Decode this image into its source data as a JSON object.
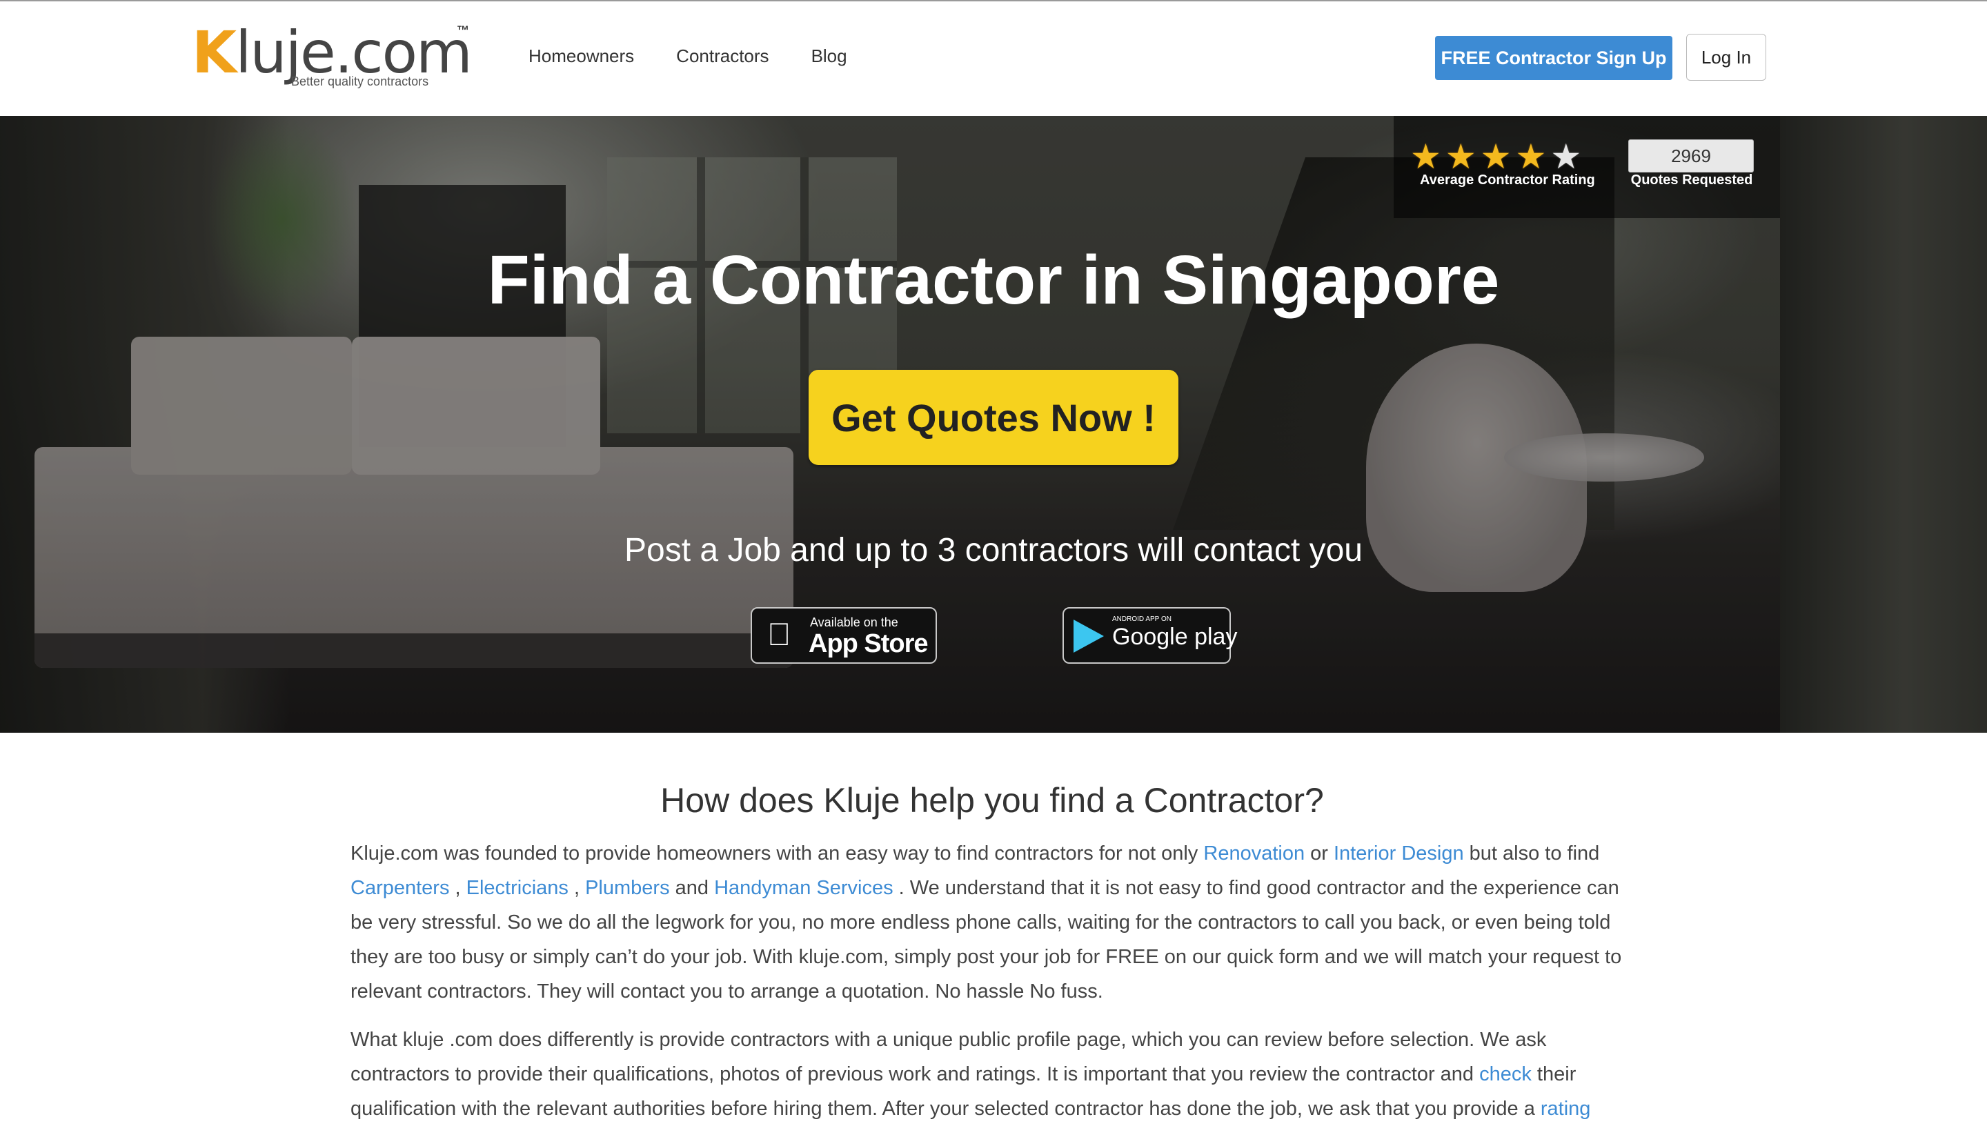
{
  "header": {
    "logo_text_k": "K",
    "logo_text_rest": "luje.com",
    "logo_tm": "™",
    "logo_tagline": "Better quality contractors",
    "nav": [
      "Homeowners",
      "Contractors",
      "Blog"
    ],
    "signup_label": "FREE Contractor Sign Up",
    "login_label": "Log In"
  },
  "hero": {
    "stars_filled": 4,
    "stars_total": 5,
    "rating_label": "Average Contractor Rating",
    "quotes_count": "2969",
    "quotes_label": "Quotes Requested",
    "title": "Find a Contractor in Singapore",
    "cta_label": "Get Quotes Now !",
    "subtitle": "Post a Job and up to 3 contractors will contact you",
    "appstore": {
      "small": "Available on the",
      "big": "App Store"
    },
    "googleplay": {
      "small": "ANDROID APP ON",
      "big": "Google play"
    }
  },
  "content": {
    "heading": "How does Kluje help you find a Contractor?",
    "p1": {
      "t1": "Kluje.com was founded to provide homeowners with an easy way to find contractors for not only ",
      "l1": "Renovation",
      "t2": " or ",
      "l2": "Interior Design",
      "t3": " but also to find ",
      "l3": "Carpenters",
      "t4": " , ",
      "l4": "Electricians",
      "t5": " , ",
      "l5": "Plumbers",
      "t6": " and ",
      "l6": "Handyman Services",
      "t7": " . We understand that it is not easy to find good contractor and the experience can be very stressful. So we do all the legwork for you, no more endless phone calls, waiting for the contractors to call you back, or even being told they are too busy or simply can’t do your job. With kluje.com, simply post your job for FREE on our quick form and we will match your request to relevant contractors. They will contact you to arrange a quotation. No hassle No fuss."
    },
    "p2": {
      "t1": "What kluje .com does differently is provide contractors with a unique public profile page, which you can review before selection. We ask contractors to provide their qualifications, photos of previous work and ratings. It is important that you review the contractor and ",
      "l1": "check",
      "t2": " their qualification with the relevant authorities before hiring them. After your selected contractor has done the job, we ask that you provide a ",
      "l2": "rating"
    }
  },
  "colors": {
    "accent_blue": "#3d8bd4",
    "cta_yellow": "#f6d21e",
    "logo_orange": "#f0a11b"
  }
}
